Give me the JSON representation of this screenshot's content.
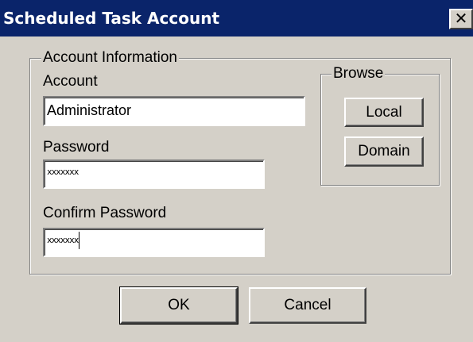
{
  "window": {
    "title": "Scheduled Task Account",
    "close_glyph": "✕"
  },
  "account_group": {
    "legend": "Account Information",
    "account_label": "Account",
    "account_value": "Administrator",
    "password_label": "Password",
    "password_value": "xxxxxxx",
    "confirm_label": "Confirm Password",
    "confirm_value": "xxxxxxx"
  },
  "browse_group": {
    "legend": "Browse",
    "local_label": "Local",
    "domain_label": "Domain"
  },
  "buttons": {
    "ok_label": "OK",
    "cancel_label": "Cancel"
  },
  "colors": {
    "title_bar": "#0a246a",
    "dialog_bg": "#d4d0c8"
  },
  "icons": {
    "close": "close-icon"
  }
}
